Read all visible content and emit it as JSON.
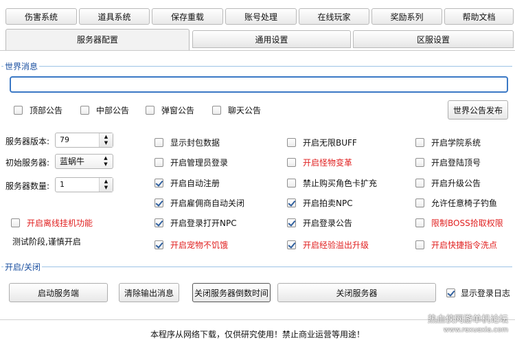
{
  "top_tabs": [
    "伤害系统",
    "道具系统",
    "保存重载",
    "账号处理",
    "在线玩家",
    "奖励系列",
    "帮助文档"
  ],
  "sub_tabs": [
    "服务器配置",
    "通用设置",
    "区服设置"
  ],
  "world_message": {
    "group_label": "世界消息",
    "input_value": "",
    "positions": [
      {
        "label": "顶部公告",
        "checked": false
      },
      {
        "label": "中部公告",
        "checked": false
      },
      {
        "label": "弹窗公告",
        "checked": false
      },
      {
        "label": "聊天公告",
        "checked": false
      }
    ],
    "publish_button": "世界公告发布"
  },
  "server_fields": {
    "version_label": "服务器版本:",
    "version_value": "79",
    "init_label": "初始服务器:",
    "init_value": "蓝蜗牛",
    "count_label": "服务器数量:",
    "count_value": "1"
  },
  "options": {
    "col1": [
      {
        "label": "显示封包数据",
        "checked": false,
        "red": false
      },
      {
        "label": "开启管理员登录",
        "checked": false,
        "red": false
      },
      {
        "label": "开启自动注册",
        "checked": true,
        "red": false
      },
      {
        "label": "开启雇佣商自动关闭",
        "checked": true,
        "red": false
      },
      {
        "label": "开启登录打开NPC",
        "checked": true,
        "red": false
      },
      {
        "label": "开启宠物不饥饿",
        "checked": true,
        "red": true
      }
    ],
    "col2": [
      {
        "label": "开启无限BUFF",
        "checked": false,
        "red": false
      },
      {
        "label": "开启怪物变革",
        "checked": false,
        "red": true
      },
      {
        "label": "禁止购买角色卡扩充",
        "checked": false,
        "red": false
      },
      {
        "label": "开启拍卖NPC",
        "checked": true,
        "red": false
      },
      {
        "label": "开启登录公告",
        "checked": true,
        "red": false
      },
      {
        "label": "开启经验溢出升级",
        "checked": true,
        "red": true
      }
    ],
    "col3": [
      {
        "label": "开启学院系统",
        "checked": false,
        "red": false
      },
      {
        "label": "开启登陆顶号",
        "checked": false,
        "red": false
      },
      {
        "label": "开启升级公告",
        "checked": false,
        "red": false
      },
      {
        "label": "允许任意椅子钓鱼",
        "checked": false,
        "red": false
      },
      {
        "label": "限制BOSS拾取权限",
        "checked": false,
        "red": true
      },
      {
        "label": "开启快捷指令洗点",
        "checked": false,
        "red": true
      }
    ],
    "offline": {
      "label": "开启离线挂机功能",
      "checked": false,
      "red": true
    },
    "note": "测试阶段,谨慎开启"
  },
  "power": {
    "group_label": "开启/关闭",
    "start_button": "启动服务端",
    "clear_button": "清除输出消息",
    "countdown_button": "关闭服务器倒数时间",
    "stop_button": "关闭服务器",
    "show_login_log": {
      "label": "显示登录日志",
      "checked": true
    }
  },
  "footer": "本程序从网络下载，仅供研究使用！禁止商业运营等用途！",
  "watermark": {
    "line1": "热血侠网游单机论坛",
    "line2": "www.rexuexia.com"
  }
}
